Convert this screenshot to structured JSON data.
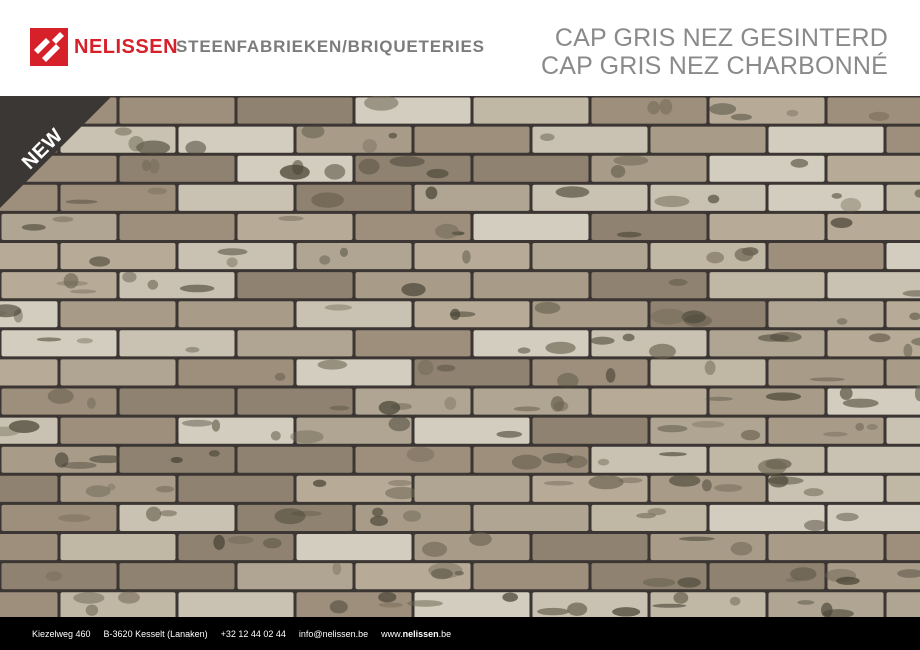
{
  "brand": {
    "name": "NELISSEN",
    "subtitle": "STEENFABRIEKEN/BRIQUETERIES",
    "logo_colors": {
      "red": "#d6202a",
      "white": "#ffffff"
    }
  },
  "title": {
    "line1": "CAP GRIS NEZ GESINTERD",
    "line2": "CAP GRIS NEZ CHARBONNÉ"
  },
  "badge": {
    "label": "NEW",
    "color": "#3a3735"
  },
  "product_image": {
    "description_icon": "brick-wall-swatch"
  },
  "footer": {
    "address": "Kiezelweg 460",
    "city": "B-3620 Kesselt (Lanaken)",
    "phone": "+32 12 44 02 44",
    "email": "info@nelissen.be",
    "web_prefix": "www.",
    "web_domain": "nelissen",
    "web_suffix": ".be"
  },
  "colors": {
    "brand_red": "#d6202a",
    "title_grey": "#8a8a8a",
    "footer_bg": "#000000",
    "mortar": "#3b3633"
  }
}
